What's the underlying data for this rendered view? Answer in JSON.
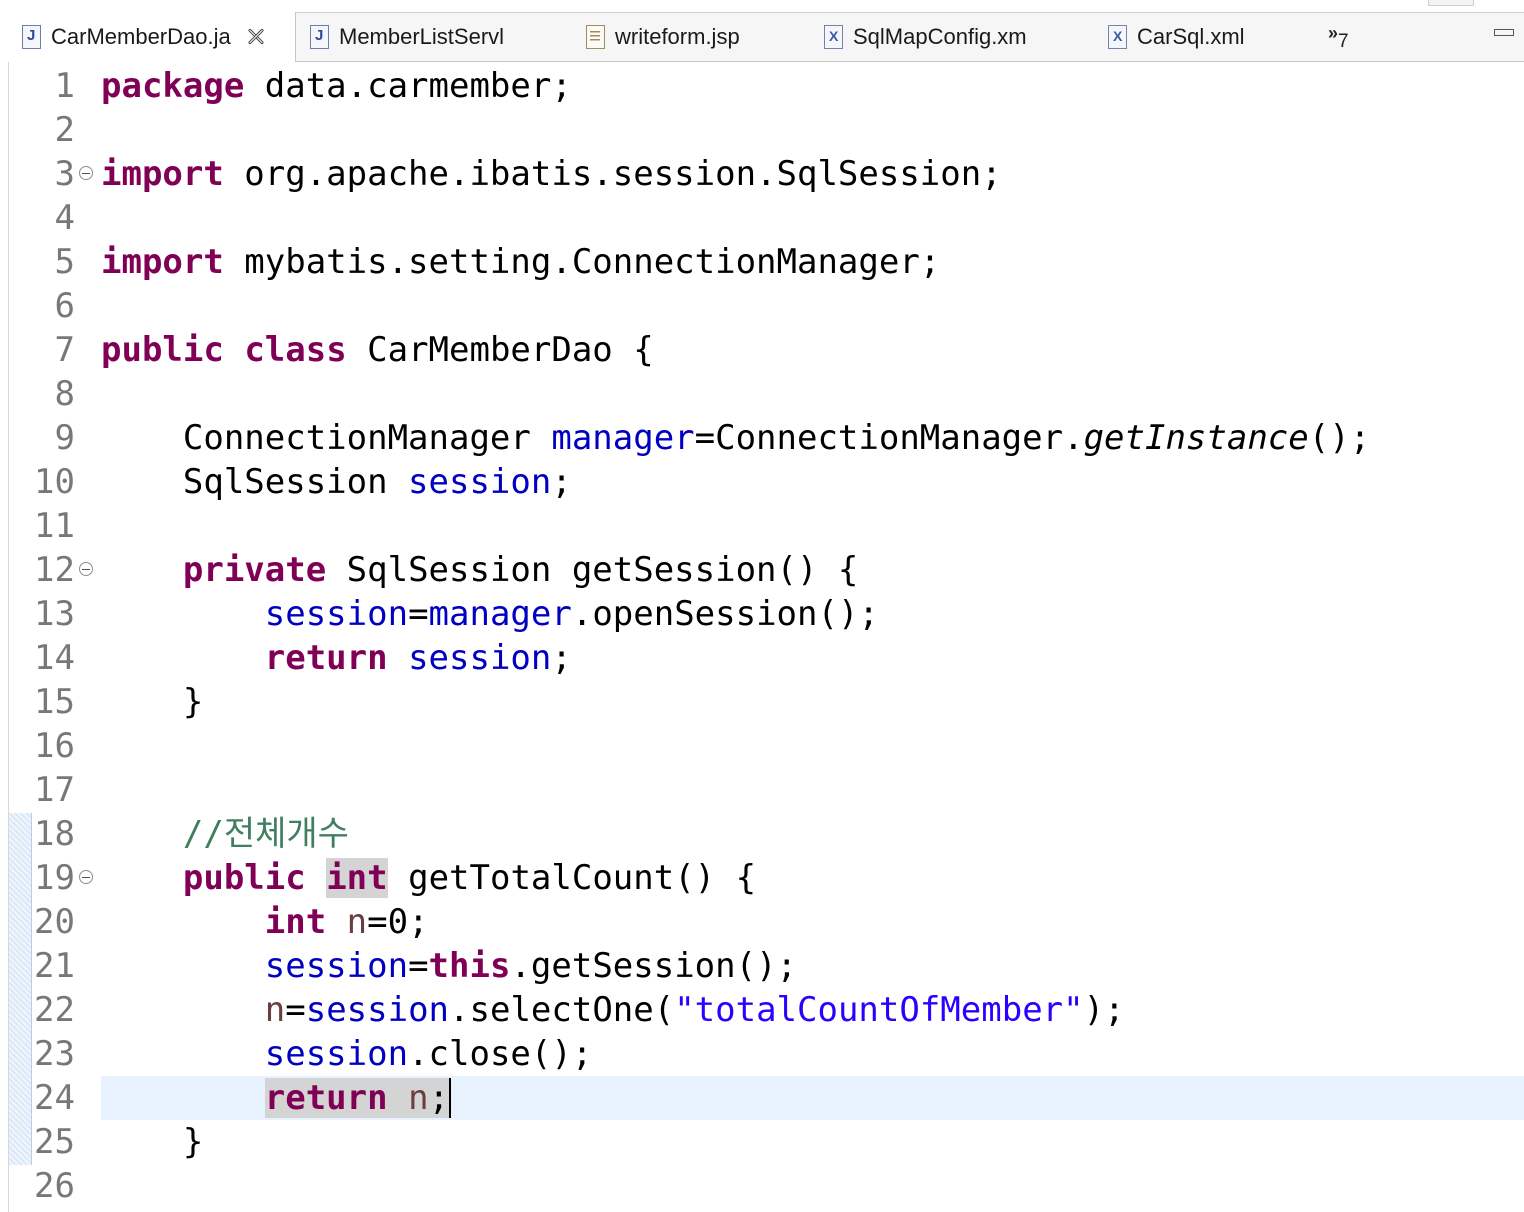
{
  "tabs": [
    {
      "label": "CarMemberDao.ja",
      "icon": "java-file-icon",
      "active": true
    },
    {
      "label": "MemberListServl",
      "icon": "java-file-icon"
    },
    {
      "label": "writeform.jsp",
      "icon": "jsp-file-icon"
    },
    {
      "label": "SqlMapConfig.xm",
      "icon": "xml-file-icon"
    },
    {
      "label": "CarSql.xml",
      "icon": "xml-file-icon"
    }
  ],
  "overflow": {
    "chevron": "»",
    "count": "7"
  },
  "editor": {
    "current_line": 24,
    "lines": [
      {
        "n": "1",
        "t": [
          [
            "kw",
            "package"
          ],
          [
            "p",
            " data.carmember;"
          ]
        ]
      },
      {
        "n": "2",
        "t": []
      },
      {
        "n": "3",
        "fold": true,
        "t": [
          [
            "kw",
            "import"
          ],
          [
            "p",
            " org.apache.ibatis.session.SqlSession;"
          ]
        ]
      },
      {
        "n": "4",
        "t": []
      },
      {
        "n": "5",
        "t": [
          [
            "kw",
            "import"
          ],
          [
            "p",
            " mybatis.setting.ConnectionManager;"
          ]
        ]
      },
      {
        "n": "6",
        "t": []
      },
      {
        "n": "7",
        "t": [
          [
            "kw",
            "public"
          ],
          [
            "p",
            " "
          ],
          [
            "kw",
            "class"
          ],
          [
            "p",
            " CarMemberDao {"
          ]
        ]
      },
      {
        "n": "8",
        "t": []
      },
      {
        "n": "9",
        "t": [
          [
            "p",
            "    ConnectionManager "
          ],
          [
            "fld",
            "manager"
          ],
          [
            "p",
            "=ConnectionManager."
          ],
          [
            "it",
            "getInstance"
          ],
          [
            "p",
            "();"
          ]
        ]
      },
      {
        "n": "10",
        "t": [
          [
            "p",
            "    SqlSession "
          ],
          [
            "fld",
            "session"
          ],
          [
            "p",
            ";"
          ]
        ]
      },
      {
        "n": "11",
        "t": []
      },
      {
        "n": "12",
        "fold": true,
        "t": [
          [
            "p",
            "    "
          ],
          [
            "kw",
            "private"
          ],
          [
            "p",
            " SqlSession getSession() {"
          ]
        ]
      },
      {
        "n": "13",
        "t": [
          [
            "p",
            "        "
          ],
          [
            "fld",
            "session"
          ],
          [
            "p",
            "="
          ],
          [
            "fld",
            "manager"
          ],
          [
            "p",
            ".openSession();"
          ]
        ]
      },
      {
        "n": "14",
        "t": [
          [
            "p",
            "        "
          ],
          [
            "kw",
            "return"
          ],
          [
            "p",
            " "
          ],
          [
            "fld",
            "session"
          ],
          [
            "p",
            ";"
          ]
        ]
      },
      {
        "n": "15",
        "t": [
          [
            "p",
            "    }"
          ]
        ]
      },
      {
        "n": "16",
        "t": []
      },
      {
        "n": "17",
        "t": []
      },
      {
        "n": "18",
        "t": [
          [
            "p",
            "    "
          ],
          [
            "cmt",
            "//전체개수"
          ]
        ]
      },
      {
        "n": "19",
        "fold": true,
        "t": [
          [
            "p",
            "    "
          ],
          [
            "kw",
            "public"
          ],
          [
            "p",
            " "
          ],
          [
            "kwocc",
            "int"
          ],
          [
            "p",
            " getTotalCount() {"
          ]
        ]
      },
      {
        "n": "20",
        "t": [
          [
            "p",
            "        "
          ],
          [
            "kw",
            "int"
          ],
          [
            "p",
            " "
          ],
          [
            "var",
            "n"
          ],
          [
            "p",
            "=0;"
          ]
        ]
      },
      {
        "n": "21",
        "t": [
          [
            "p",
            "        "
          ],
          [
            "fld",
            "session"
          ],
          [
            "p",
            "="
          ],
          [
            "kw",
            "this"
          ],
          [
            "p",
            ".getSession();"
          ]
        ]
      },
      {
        "n": "22",
        "t": [
          [
            "p",
            "        "
          ],
          [
            "var",
            "n"
          ],
          [
            "p",
            "="
          ],
          [
            "fld",
            "session"
          ],
          [
            "p",
            ".selectOne("
          ],
          [
            "str",
            "\"totalCountOfMember\""
          ],
          [
            "p",
            ");"
          ]
        ]
      },
      {
        "n": "23",
        "t": [
          [
            "p",
            "        "
          ],
          [
            "fld",
            "session"
          ],
          [
            "p",
            ".close();"
          ]
        ]
      },
      {
        "n": "24",
        "caret": true,
        "t": [
          [
            "p",
            "        "
          ],
          [
            "kwocc",
            "return"
          ],
          [
            "occ",
            " "
          ],
          [
            "varocc",
            "n"
          ],
          [
            "occ",
            ";"
          ]
        ]
      },
      {
        "n": "25",
        "t": [
          [
            "p",
            "    }"
          ]
        ]
      },
      {
        "n": "26",
        "t": []
      }
    ]
  }
}
